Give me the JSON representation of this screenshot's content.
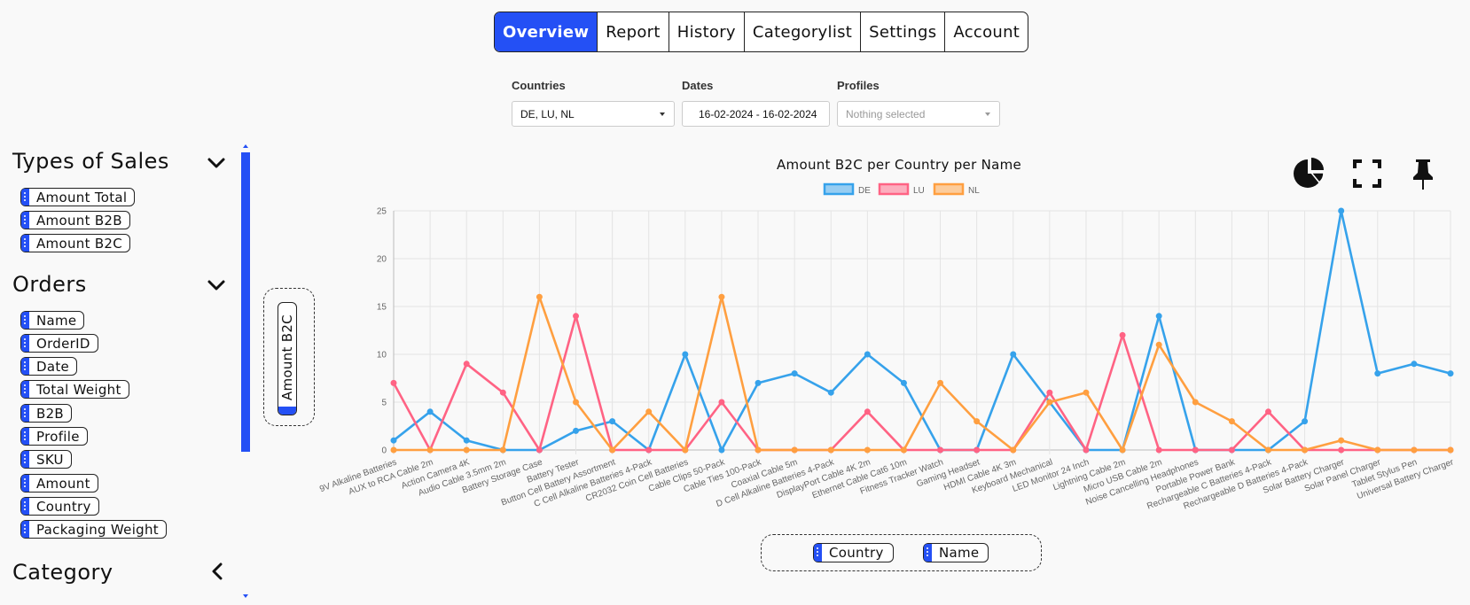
{
  "tabs": [
    {
      "label": "Overview",
      "active": true
    },
    {
      "label": "Report"
    },
    {
      "label": "History"
    },
    {
      "label": "Categorylist"
    },
    {
      "label": "Settings"
    },
    {
      "label": "Account"
    }
  ],
  "filters": {
    "countries": {
      "label": "Countries",
      "value": "DE, LU, NL"
    },
    "dates": {
      "label": "Dates",
      "value": "16-02-2024 - 16-02-2024"
    },
    "profiles": {
      "label": "Profiles",
      "placeholder": "Nothing selected"
    }
  },
  "sidebar": {
    "types_of_sales": {
      "title": "Types of Sales",
      "items": [
        "Amount Total",
        "Amount B2B",
        "Amount B2C"
      ]
    },
    "orders": {
      "title": "Orders",
      "items": [
        "Name",
        "OrderID",
        "Date",
        "Total Weight",
        "B2B",
        "Profile",
        "SKU",
        "Amount",
        "Country",
        "Packaging Weight"
      ]
    },
    "category": {
      "title": "Category"
    }
  },
  "value_zone": {
    "chip": "Amount B2C"
  },
  "axis_zone": {
    "chips": [
      "Country",
      "Name"
    ]
  },
  "colors": {
    "accent": "#2450f5",
    "de": "#36a2eb",
    "lu": "#ff6384",
    "nl": "#ff9f40"
  },
  "icons": [
    "pie-chart-icon",
    "fullscreen-icon",
    "pin-icon",
    "chevron-down-icon",
    "chevron-left-icon"
  ],
  "chart_data": {
    "type": "line",
    "title": "Amount B2C per Country per Name",
    "ylim": [
      0,
      25
    ],
    "y_ticks": [
      0,
      5,
      10,
      15,
      20,
      25
    ],
    "grid": true,
    "legend_position": "top",
    "categories": [
      "9V Alkaline Batteries",
      "AUX to RCA Cable 2m",
      "Action Camera 4K",
      "Audio Cable 3.5mm 2m",
      "Battery Storage Case",
      "Battery Tester",
      "Button Cell Battery Assortment",
      "C Cell Alkaline Batteries 4-Pack",
      "CR2032 Coin Cell Batteries",
      "Cable Clips 50-Pack",
      "Cable Ties 100-Pack",
      "Coaxial Cable 5m",
      "D Cell Alkaline Batteries 4-Pack",
      "DisplayPort Cable 4K 2m",
      "Ethernet Cable Cat6 10m",
      "Fitness Tracker Watch",
      "Gaming Headset",
      "HDMI Cable 4K 3m",
      "Keyboard Mechanical",
      "LED Monitor 24 Inch",
      "Lightning Cable 2m",
      "Micro USB Cable 2m",
      "Noise Cancelling Headphones",
      "Portable Power Bank",
      "Rechargeable C Batteries 4-Pack",
      "Rechargeable D Batteries 4-Pack",
      "Solar Battery Charger",
      "Solar Panel Charger",
      "Tablet Stylus Pen",
      "Universal Battery Charger"
    ],
    "series": [
      {
        "name": "DE",
        "color": "#36a2eb",
        "values": [
          1,
          4,
          1,
          0,
          0,
          2,
          3,
          0,
          10,
          0,
          7,
          8,
          6,
          10,
          7,
          0,
          0,
          10,
          5,
          0,
          0,
          14,
          0,
          0,
          0,
          3,
          25,
          8,
          9,
          8
        ]
      },
      {
        "name": "LU",
        "color": "#ff6384",
        "values": [
          7,
          0,
          9,
          6,
          0,
          14,
          0,
          0,
          0,
          5,
          0,
          0,
          0,
          4,
          0,
          0,
          0,
          0,
          6,
          0,
          12,
          0,
          0,
          0,
          4,
          0,
          0,
          0,
          0,
          0
        ]
      },
      {
        "name": "NL",
        "color": "#ff9f40",
        "values": [
          0,
          0,
          0,
          0,
          16,
          5,
          0,
          4,
          0,
          16,
          0,
          0,
          0,
          0,
          0,
          7,
          3,
          0,
          5,
          6,
          0,
          11,
          5,
          3,
          0,
          0,
          1,
          0,
          0,
          0
        ]
      }
    ]
  }
}
